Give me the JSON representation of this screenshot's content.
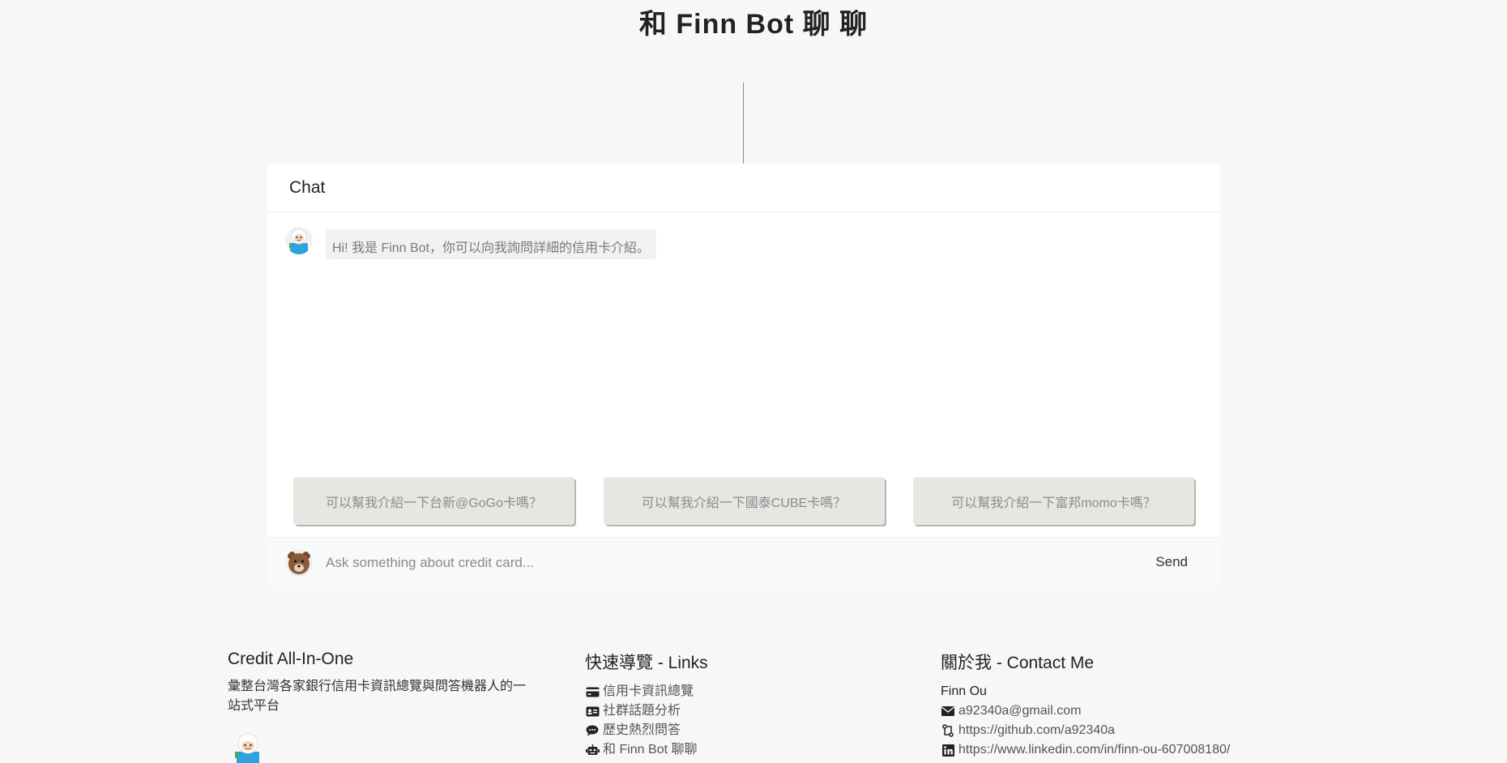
{
  "header": {
    "title": "和 Finn Bot 聊 聊"
  },
  "chat": {
    "header_title": "Chat",
    "messages": [
      {
        "sender": "bot",
        "text": "Hi! 我是 Finn Bot，你可以向我詢問詳細的信用卡介紹。"
      }
    ],
    "suggestions": [
      "可以幫我介紹一下台新@GoGo卡嗎？",
      "可以幫我介紹一下國泰CUBE卡嗎？",
      "可以幫我介紹一下富邦momo卡嗎？"
    ],
    "input_placeholder": "Ask something about credit card...",
    "input_value": "",
    "send_label": "Send"
  },
  "footer": {
    "about": {
      "title": "Credit All-In-One",
      "description": "彙整台灣各家銀行信用卡資訊總覽與問答機器人的一站式平台"
    },
    "links": {
      "title": "快速導覽 - Links",
      "items": [
        {
          "label": "信用卡資訊總覽",
          "icon": "credit-card-icon"
        },
        {
          "label": "社群話題分析",
          "icon": "id-card-icon"
        },
        {
          "label": "歷史熱烈問答",
          "icon": "comments-icon"
        },
        {
          "label": "和 Finn Bot 聊聊",
          "icon": "robot-icon"
        }
      ]
    },
    "contact": {
      "title": "關於我 - Contact Me",
      "name": "Finn Ou",
      "email": "a92340a@gmail.com",
      "github": "https://github.com/a92340a",
      "linkedin": "https://www.linkedin.com/in/finn-ou-607008180/"
    }
  },
  "colors": {
    "background": "#f7f7f7",
    "card": "#ffffff",
    "bubble": "#f1f1f1",
    "suggestion": "#e8e6e3"
  }
}
